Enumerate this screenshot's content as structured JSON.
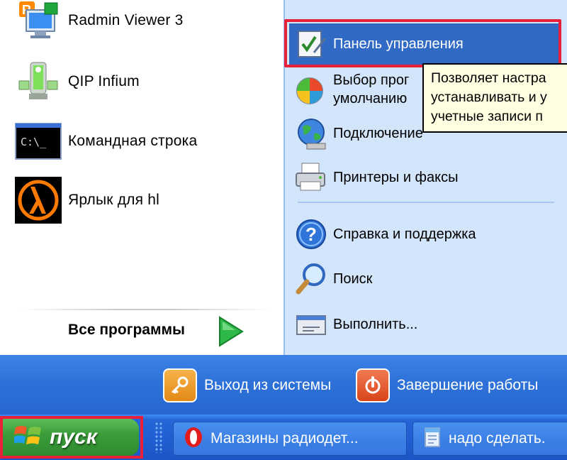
{
  "left_pane": {
    "programs": [
      {
        "label": "Radmin Viewer 3",
        "icon": "radmin-viewer-icon"
      },
      {
        "label": "QIP Infium",
        "icon": "qip-infium-icon"
      },
      {
        "label": "Командная строка",
        "icon": "command-prompt-icon"
      },
      {
        "label": "Ярлык для hl",
        "icon": "half-life-icon"
      }
    ],
    "all_programs_label": "Все программы",
    "all_programs_icon": "green-arrow-icon"
  },
  "right_pane": {
    "items": [
      {
        "label": "Панель управления",
        "icon": "control-panel-icon",
        "highlighted": true
      },
      {
        "label_line1": "Выбор прог",
        "label_line2": "умолчанию",
        "icon": "default-programs-icon"
      },
      {
        "label": "Подключение",
        "icon": "network-connections-icon"
      },
      {
        "label": "Принтеры и факсы",
        "icon": "printers-icon"
      },
      {
        "label": "Справка и поддержка",
        "icon": "help-icon"
      },
      {
        "label": "Поиск",
        "icon": "search-icon"
      },
      {
        "label": "Выполнить...",
        "icon": "run-icon"
      }
    ]
  },
  "tooltip": {
    "line1": "Позволяет настра",
    "line2": "устанавливать и у",
    "line3": "учетные записи п"
  },
  "bottom_bar": {
    "logoff_label": "Выход из системы",
    "shutdown_label": "Завершение работы"
  },
  "taskbar": {
    "start_label": "пуск",
    "tasks": [
      {
        "label": "Магазины радиодет...",
        "icon": "opera-icon"
      },
      {
        "label": "надо сделать.",
        "icon": "notepad-icon"
      }
    ]
  },
  "colors": {
    "selection_blue": "#316ac5",
    "right_pane_bg": "#d3e5fa",
    "highlight_red": "#e8213a",
    "taskbar_blue": "#2466d6",
    "start_green": "#3a9d3a",
    "tooltip_bg": "#ffffe1"
  }
}
